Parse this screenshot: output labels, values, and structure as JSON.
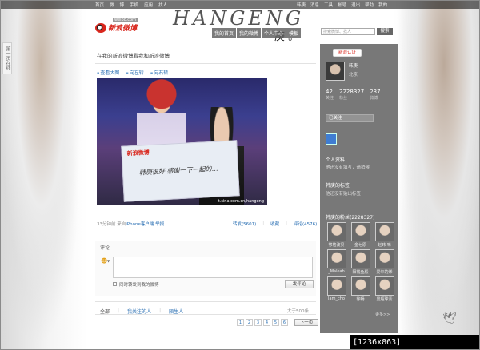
{
  "topbar": {
    "nav_left": [
      "首页",
      "微",
      "博",
      "手机",
      "应用",
      "找人"
    ],
    "nav_right": [
      "韩庚",
      "消息",
      "工具",
      "帐号",
      "退出",
      "帮助",
      "我的"
    ]
  },
  "header": {
    "logo_text": "新浪微博",
    "logo_url": "weibo.com",
    "deco_text": "HANGENG",
    "deco_chars": "庚 。 "
  },
  "side_tab": "第一页在线",
  "mainnav": [
    "我的首页",
    "我的微博",
    "个人中心",
    "模板"
  ],
  "search": {
    "placeholder": "搜索微博、找人",
    "button": "搜索"
  },
  "post": {
    "title": "在我的新浪微博看我和新浪微博",
    "tools": [
      "查看大图",
      "向左转",
      "向右转"
    ],
    "image": {
      "sign_logo": "新浪微博",
      "sign_handwriting": "韩庚很好 感谢一下一起的…",
      "watermark": "t.sina.com.cn/hangeng"
    },
    "meta_time": "33分钟前",
    "meta_from": "来自",
    "meta_client": "iPhone客户端",
    "meta_report": "举报",
    "actions": [
      "转发(5601)",
      "收藏",
      "评论(4576)"
    ]
  },
  "comment": {
    "label": "评论",
    "repost_label": "同时转发到我的微博",
    "submit": "发评论",
    "filters": [
      "全部",
      "我关注的人",
      "陌生人"
    ],
    "count": "大于500条",
    "pages": [
      "1",
      "2",
      "3",
      "4",
      "5",
      "6"
    ],
    "next": "下一页"
  },
  "sidebar": {
    "badge": "新浪认证",
    "name": "韩庚",
    "location": "北京",
    "stats": [
      {
        "num": "42",
        "label": "关注"
      },
      {
        "num": "2228327",
        "label": "粉丝"
      },
      {
        "num": "237",
        "label": "微博"
      }
    ],
    "followed": "已关注",
    "profile_title": "个人资料",
    "profile_text": "他还没有填写，请稍候",
    "tags_title": "韩庚的标签",
    "tags_text": "他还没有贴出标签",
    "fans_title": "韩庚的粉丝(2228327)",
    "fans": [
      "够格波贝",
      "金七原",
      "赵玮·咪",
      "_Maleah",
      "阳钱鱼殿",
      "爱尔的烯",
      "Iam_cho",
      "徐畅",
      "曼超球素"
    ],
    "more": "更多>>"
  },
  "stamp": "[1236x863] https://upic.me/"
}
